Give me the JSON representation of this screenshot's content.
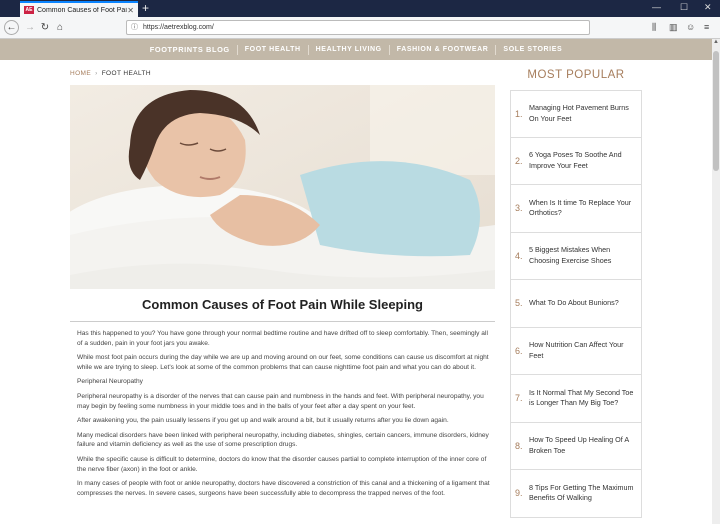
{
  "browser": {
    "tab_title": "Common Causes of Foot Pain",
    "favicon_text": "AE",
    "url": "https://aetrexblog.com/"
  },
  "site_nav": {
    "items": [
      "FOOTPRINTS BLOG",
      "FOOT HEALTH",
      "HEALTHY LIVING",
      "FASHION & FOOTWEAR",
      "SOLE STORIES"
    ]
  },
  "breadcrumb": {
    "home": "HOME",
    "separator": "›",
    "current": "FOOT HEALTH"
  },
  "article": {
    "title": "Common Causes of Foot Pain While Sleeping",
    "paragraphs": [
      "Has this happened to you? You have gone through your normal bedtime routine and have drifted off to sleep comfortably. Then, seemingly all of a sudden, pain in your foot jars you awake.",
      "While most foot pain occurs during the day while we are up and moving around on our feet, some conditions can cause us discomfort at night while we are trying to sleep. Let's look at some of the common problems that can cause nighttime foot pain and what you can do about it.",
      "Peripheral Neuropathy",
      "Peripheral neuropathy is a disorder of the nerves that can cause pain and numbness in the hands and feet. With peripheral neuropathy, you may begin by feeling some numbness in your middle toes and in the balls of your feet after a day spent on your feet.",
      "After awakening you, the pain usually lessens if you get up and walk around a bit, but it usually returns after you lie down again.",
      "Many medical disorders have been linked with peripheral neuropathy, including diabetes, shingles, certain cancers, immune disorders, kidney failure and vitamin deficiency as well as the use of some prescription drugs.",
      "While the specific cause is difficult to determine, doctors do know that the disorder causes partial to complete interruption of the inner core of the nerve fiber (axon) in the foot or ankle.",
      "In many cases of people with foot or ankle neuropathy, doctors have discovered a constriction of this canal and a thickening of a ligament that compresses the nerves. In severe cases, surgeons have been successfully able to decompress the trapped nerves of the foot."
    ]
  },
  "sidebar": {
    "title": "MOST POPULAR",
    "items": [
      {
        "num": "1.",
        "text": "Managing Hot Pavement Burns On Your Feet"
      },
      {
        "num": "2.",
        "text": "6 Yoga Poses To Soothe And Improve Your Feet"
      },
      {
        "num": "3.",
        "text": "When Is It time To Replace Your Orthotics?"
      },
      {
        "num": "4.",
        "text": "5 Biggest Mistakes When Choosing Exercise Shoes"
      },
      {
        "num": "5.",
        "text": "What To Do About Bunions?"
      },
      {
        "num": "6.",
        "text": "How Nutrition Can Affect Your Feet"
      },
      {
        "num": "7.",
        "text": "Is It Normal That My Second Toe is Longer Than My Big Toe?"
      },
      {
        "num": "8.",
        "text": "How To Speed Up Healing Of A Broken Toe"
      },
      {
        "num": "9.",
        "text": "8 Tips For Getting The Maximum Benefits Of Walking"
      }
    ]
  },
  "colors": {
    "accent": "#a67d5c",
    "nav_bg": "#c2b8a8",
    "tabbar_bg": "#1c2744"
  }
}
